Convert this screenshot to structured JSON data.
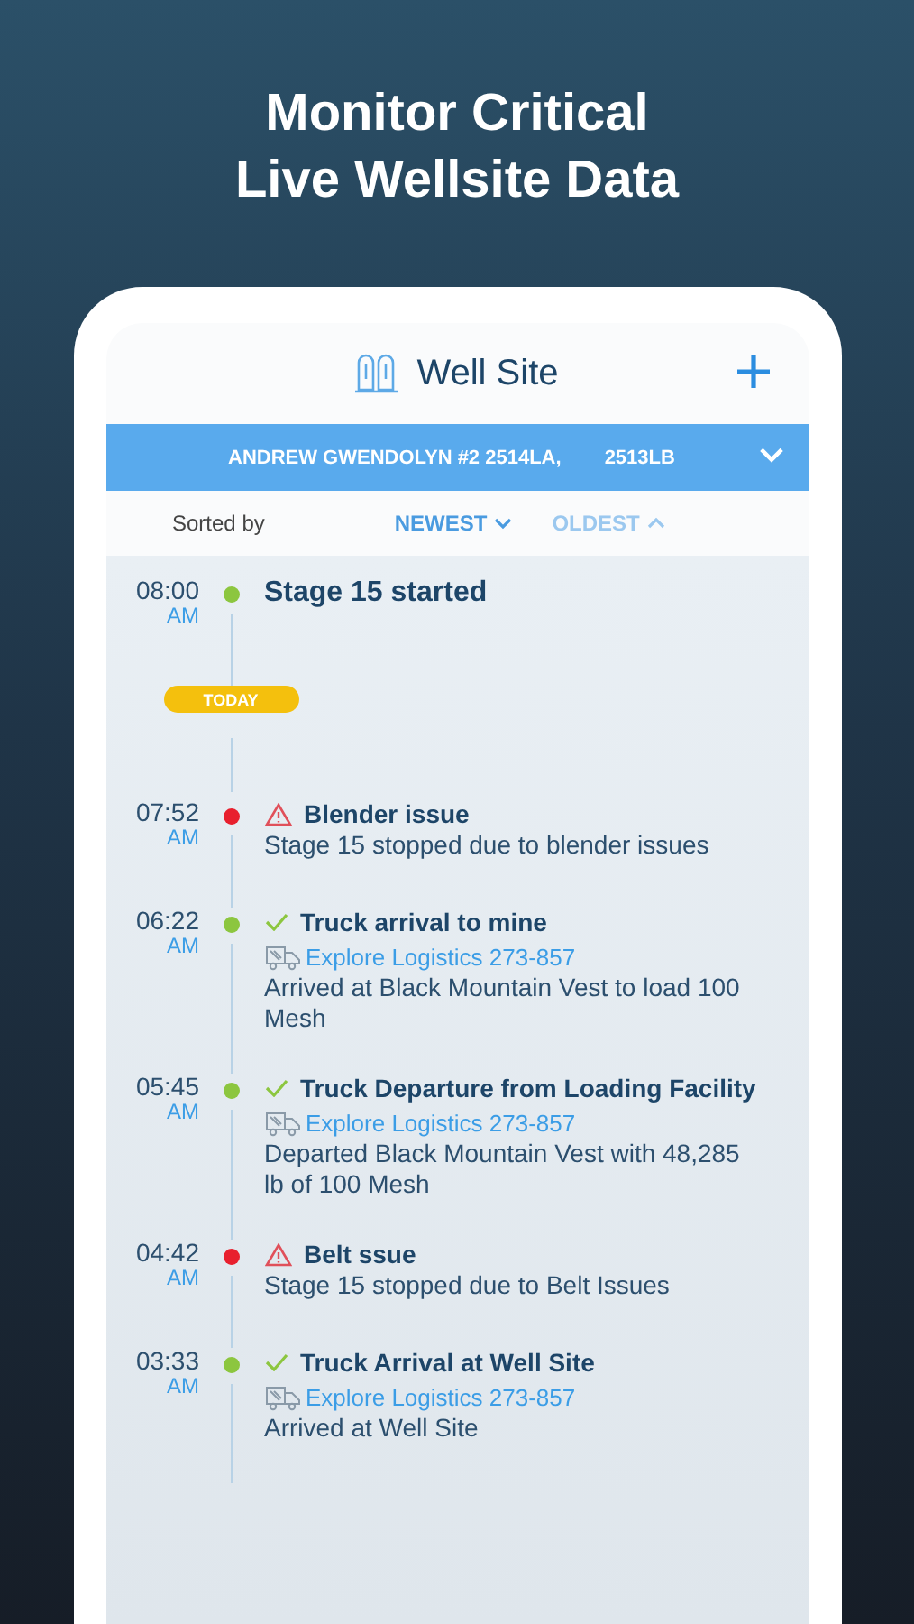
{
  "headline": [
    "Monitor Critical",
    "Live Wellsite Data"
  ],
  "header": {
    "title": "Well Site"
  },
  "site_bar": {
    "name": "ANDREW GWENDOLYN #2 2514LA,",
    "code": "2513LB"
  },
  "sort": {
    "label": "Sorted by",
    "options": [
      {
        "label": "NEWEST",
        "kind": "down",
        "selected": true
      },
      {
        "label": "OLDEST",
        "kind": "up",
        "selected": false
      }
    ]
  },
  "timeline": [
    {
      "kind": "start",
      "time": "08:00",
      "ampm": "AM",
      "color": "#8cc63f",
      "title": "Stage 15 started"
    },
    {
      "kind": "day",
      "label": "TODAY"
    },
    {
      "kind": "issue",
      "time": "07:52",
      "ampm": "AM",
      "color": "#e8202e",
      "title": "Blender issue",
      "detail": "Stage 15 stopped due to blender issues"
    },
    {
      "kind": "truck",
      "time": "06:22",
      "ampm": "AM",
      "color": "#8cc63f",
      "title": "Truck arrival to mine",
      "carrier": "Explore Logistics 273-857",
      "detail": "Arrived at Black Mountain Vest to load 100 Mesh"
    },
    {
      "kind": "truck",
      "time": "05:45",
      "ampm": "AM",
      "color": "#8cc63f",
      "title": "Truck Departure from  Loading Facility",
      "carrier": "Explore Logistics 273-857",
      "detail": "Departed Black Mountain Vest with 48,285 lb of 100 Mesh"
    },
    {
      "kind": "issue",
      "time": "04:42",
      "ampm": "AM",
      "color": "#e8202e",
      "title": "Belt ssue",
      "detail": "Stage 15 stopped due to Belt Issues"
    },
    {
      "kind": "truck",
      "time": "03:33",
      "ampm": "AM",
      "color": "#8cc63f",
      "title": "Truck Arrival at Well Site",
      "carrier": "Explore Logistics 273-857",
      "detail": "Arrived at Well Site"
    }
  ]
}
